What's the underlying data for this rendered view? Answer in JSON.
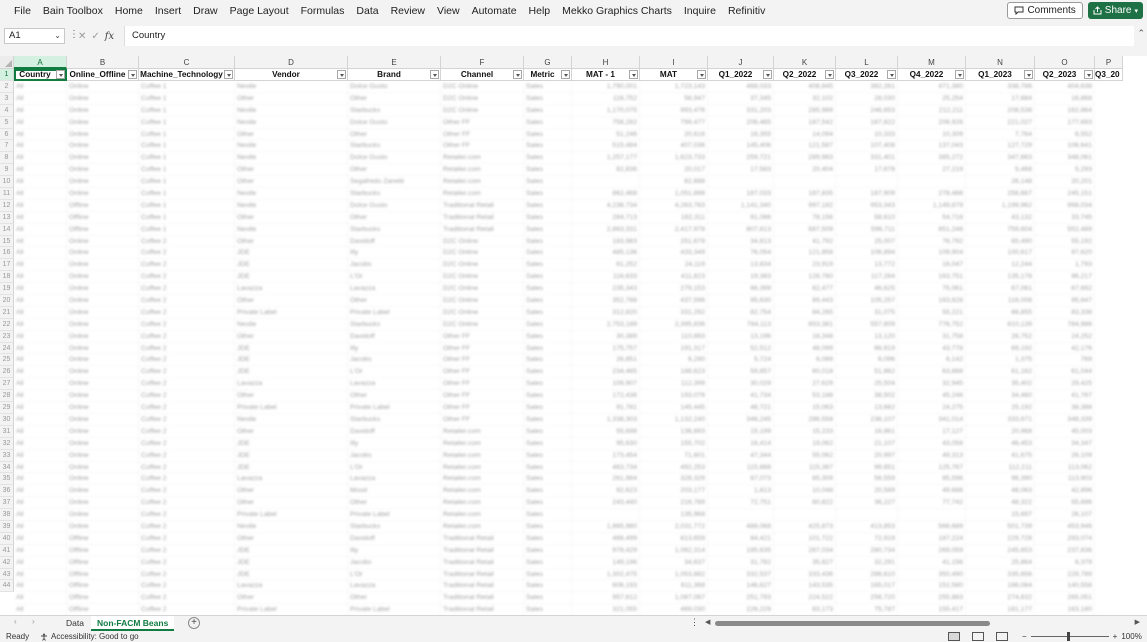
{
  "menu": {
    "items": [
      "File",
      "Bain Toolbox",
      "Home",
      "Insert",
      "Draw",
      "Page Layout",
      "Formulas",
      "Data",
      "Review",
      "View",
      "Automate",
      "Help",
      "Mekko Graphics Charts",
      "Inquire",
      "Refinitiv"
    ],
    "comments_label": "Comments",
    "share_label": "Share"
  },
  "formula_bar": {
    "name_box": "A1",
    "fx_label": "fx",
    "content": "Country"
  },
  "columns": {
    "letters": [
      "A",
      "B",
      "C",
      "D",
      "E",
      "F",
      "G",
      "H",
      "I",
      "J",
      "K",
      "L",
      "M",
      "N",
      "O",
      "P"
    ],
    "headers": [
      "Country",
      "Online_Offline",
      "Machine_Technology",
      "Vendor",
      "Brand",
      "Channel",
      "Metric",
      "MAT - 1",
      "MAT",
      "Q1_2022",
      "Q2_2022",
      "Q3_2022",
      "Q4_2022",
      "Q1_2023",
      "Q2_2023",
      "Q3_20"
    ]
  },
  "row_numbers": [
    "1",
    "2",
    "3",
    "4",
    "5",
    "6",
    "7",
    "8",
    "9",
    "10",
    "11",
    "12",
    "13",
    "14",
    "15",
    "16",
    "17",
    "18",
    "19",
    "20",
    "21",
    "22",
    "23",
    "24",
    "25",
    "26",
    "27",
    "28",
    "29",
    "30",
    "31",
    "32",
    "33",
    "34",
    "35",
    "36",
    "37",
    "38",
    "39",
    "40",
    "41",
    "42",
    "43",
    "44"
  ],
  "rows": [
    [
      "All",
      "Online",
      "Coffee 1",
      "Nestle",
      "Dolce Gusto",
      "D2C Online",
      "Sales",
      "1,790,001",
      "1,723,143",
      "468,033",
      "408,845",
      "382,261",
      "471,380",
      "338,786",
      "404,638"
    ],
    [
      "All",
      "Online",
      "Coffee 1",
      "Other",
      "Other",
      "D2C Online",
      "Sales",
      "116,752",
      "56,947",
      "37,345",
      "32,102",
      "28,030",
      "25,254",
      "17,684",
      "16,868"
    ],
    [
      "All",
      "Online",
      "Coffee 1",
      "Nestle",
      "Starbucks",
      "D2C Online",
      "Sales",
      "1,170,075",
      "993,476",
      "331,203",
      "285,989",
      "246,653",
      "212,211",
      "208,538",
      "162,864"
    ],
    [
      "All",
      "Online",
      "Coffee 1",
      "Nestle",
      "Dolce Gusto",
      "Other FF",
      "Sales",
      "758,282",
      "799,477",
      "206,465",
      "187,542",
      "167,822",
      "206,926",
      "221,027",
      "177,693"
    ],
    [
      "All",
      "Online",
      "Coffee 1",
      "Other",
      "Other",
      "Other FF",
      "Sales",
      "51,246",
      "20,616",
      "16,355",
      "14,094",
      "10,333",
      "10,309",
      "7,764",
      "6,552"
    ],
    [
      "All",
      "Online",
      "Coffee 1",
      "Nestle",
      "Starbucks",
      "Other FF",
      "Sales",
      "515,484",
      "407,036",
      "145,406",
      "121,587",
      "107,408",
      "137,043",
      "127,729",
      "106,641"
    ],
    [
      "All",
      "Online",
      "Coffee 1",
      "Nestle",
      "Dolce Gusto",
      "Retailer.com",
      "Sales",
      "1,257,177",
      "1,623,733",
      "259,721",
      "289,983",
      "331,401",
      "385,272",
      "347,663",
      "348,061"
    ],
    [
      "All",
      "Online",
      "Coffee 1",
      "Other",
      "Other",
      "Retailer.com",
      "Sales",
      "82,836",
      "20,017",
      "17,583",
      "20,404",
      "17,678",
      "27,219",
      "5,468",
      "5,293"
    ],
    [
      "All",
      "Online",
      "Coffee 1",
      "Other",
      "Segafredo Zanetti",
      "Retailer.com",
      "Sales",
      "",
      "82,688",
      "",
      "",
      "",
      "",
      "26,148",
      "20,201"
    ],
    [
      "All",
      "Online",
      "Coffee 1",
      "Nestle",
      "Starbucks",
      "Retailer.com",
      "Sales",
      "862,468",
      "1,051,898",
      "187,033",
      "187,835",
      "187,909",
      "278,488",
      "256,667",
      "245,151"
    ],
    [
      "All",
      "Offline",
      "Coffee 1",
      "Nestle",
      "Dolce Gusto",
      "Traditional Retail",
      "Sales",
      "4,238,734",
      "4,263,783",
      "1,141,340",
      "997,182",
      "953,343",
      "1,149,879",
      "1,199,962",
      "998,034"
    ],
    [
      "All",
      "Offline",
      "Coffee 1",
      "Other",
      "Other",
      "Traditional Retail",
      "Sales",
      "284,713",
      "182,311",
      "91,086",
      "78,156",
      "58,610",
      "54,718",
      "43,132",
      "33,745"
    ],
    [
      "All",
      "Offline",
      "Coffee 1",
      "Nestle",
      "Starbucks",
      "Traditional Retail",
      "Sales",
      "2,863,331",
      "2,417,978",
      "807,813",
      "687,509",
      "596,711",
      "851,248",
      "759,604",
      "552,489"
    ],
    [
      "All",
      "Online",
      "Coffee 2",
      "Other",
      "Davidoff",
      "D2C Online",
      "Sales",
      "183,983",
      "251,679",
      "34,813",
      "41,792",
      "25,007",
      "76,792",
      "65,490",
      "55,192"
    ],
    [
      "All",
      "Online",
      "Coffee 2",
      "JDE",
      "Illy",
      "D2C Online",
      "Sales",
      "485,136",
      "433,349",
      "76,054",
      "121,858",
      "106,894",
      "109,904",
      "100,617",
      "97,620"
    ],
    [
      "All",
      "Online",
      "Coffee 2",
      "JDE",
      "Jacobs",
      "D2C Online",
      "Sales",
      "61,252",
      "24,119",
      "13,834",
      "23,919",
      "13,772",
      "16,047",
      "12,244",
      "1,793"
    ],
    [
      "All",
      "Online",
      "Coffee 2",
      "JDE",
      "L'Or",
      "D2C Online",
      "Sales",
      "116,633",
      "411,823",
      "19,383",
      "128,780",
      "117,264",
      "163,751",
      "135,178",
      "96,217"
    ],
    [
      "All",
      "Online",
      "Coffee 2",
      "Lavazza",
      "Lavazza",
      "D2C Online",
      "Sales",
      "235,343",
      "279,153",
      "66,399",
      "62,477",
      "46,625",
      "75,061",
      "67,061",
      "67,692"
    ],
    [
      "All",
      "Online",
      "Coffee 2",
      "Other",
      "Other",
      "D2C Online",
      "Sales",
      "352,788",
      "437,596",
      "95,630",
      "89,443",
      "105,257",
      "163,828",
      "116,008",
      "95,647"
    ],
    [
      "All",
      "Online",
      "Coffee 2",
      "Private Label",
      "Private Label",
      "D2C Online",
      "Sales",
      "312,820",
      "331,292",
      "82,754",
      "84,265",
      "31,075",
      "55,221",
      "66,855",
      "83,338"
    ],
    [
      "All",
      "Online",
      "Coffee 2",
      "Nestle",
      "Starbucks",
      "D2C Online",
      "Sales",
      "2,753,189",
      "2,395,836",
      "784,113",
      "653,381",
      "557,809",
      "776,752",
      "810,139",
      "784,986"
    ],
    [
      "All",
      "Online",
      "Coffee 2",
      "Other",
      "Davidoff",
      "Other FF",
      "Sales",
      "30,389",
      "110,893",
      "13,196",
      "18,348",
      "13,120",
      "31,758",
      "26,752",
      "24,252"
    ],
    [
      "All",
      "Online",
      "Coffee 2",
      "JDE",
      "Illy",
      "Other FF",
      "Sales",
      "175,757",
      "191,317",
      "52,512",
      "48,099",
      "66,919",
      "43,778",
      "69,192",
      "42,176"
    ],
    [
      "All",
      "Online",
      "Coffee 2",
      "JDE",
      "Jacobs",
      "Other FF",
      "Sales",
      "26,851",
      "6,290",
      "5,724",
      "6,089",
      "6,096",
      "6,142",
      "1,375",
      "769"
    ],
    [
      "All",
      "Online",
      "Coffee 2",
      "JDE",
      "L'Or",
      "Other FF",
      "Sales",
      "234,465",
      "188,623",
      "59,857",
      "60,018",
      "51,862",
      "63,888",
      "61,162",
      "61,044"
    ],
    [
      "All",
      "Online",
      "Coffee 2",
      "Lavazza",
      "Lavazza",
      "Other FF",
      "Sales",
      "109,907",
      "112,399",
      "30,029",
      "27,629",
      "25,504",
      "32,945",
      "35,402",
      "29,425"
    ],
    [
      "All",
      "Online",
      "Coffee 2",
      "Other",
      "Other",
      "Other FF",
      "Sales",
      "172,436",
      "193,076",
      "41,734",
      "53,188",
      "38,502",
      "45,246",
      "34,460",
      "41,767"
    ],
    [
      "All",
      "Online",
      "Coffee 2",
      "Private Label",
      "Private Label",
      "Other FF",
      "Sales",
      "91,781",
      "145,445",
      "48,721",
      "15,063",
      "13,662",
      "24,275",
      "25,192",
      "38,388"
    ],
    [
      "All",
      "Online",
      "Coffee 2",
      "Nestle",
      "Starbucks",
      "Other FF",
      "Sales",
      "1,338,303",
      "1,132,240",
      "346,245",
      "286,558",
      "236,107",
      "341,014",
      "333,671",
      "348,339"
    ],
    [
      "All",
      "Online",
      "Coffee 2",
      "Other",
      "Davidoff",
      "Retailer.com",
      "Sales",
      "55,698",
      "136,893",
      "15,199",
      "15,233",
      "16,861",
      "17,127",
      "20,968",
      "45,003"
    ],
    [
      "All",
      "Online",
      "Coffee 2",
      "JDE",
      "Illy",
      "Retailer.com",
      "Sales",
      "95,630",
      "155,702",
      "16,414",
      "19,062",
      "21,107",
      "43,058",
      "46,453",
      "34,347"
    ],
    [
      "All",
      "Online",
      "Coffee 2",
      "JDE",
      "Jacobs",
      "Retailer.com",
      "Sales",
      "173,454",
      "71,801",
      "47,344",
      "55,062",
      "20,997",
      "49,313",
      "41,675",
      "26,109"
    ],
    [
      "All",
      "Online",
      "Coffee 2",
      "JDE",
      "L'Or",
      "Retailer.com",
      "Sales",
      "463,734",
      "492,253",
      "115,888",
      "115,387",
      "99,651",
      "125,767",
      "112,211",
      "113,062"
    ],
    [
      "All",
      "Online",
      "Coffee 2",
      "Lavazza",
      "Lavazza",
      "Retailer.com",
      "Sales",
      "261,984",
      "328,329",
      "67,073",
      "65,309",
      "56,559",
      "85,596",
      "96,390",
      "113,903"
    ],
    [
      "All",
      "Online",
      "Coffee 2",
      "Other",
      "Mood",
      "Retailer.com",
      "Sales",
      "92,623",
      "203,177",
      "1,813",
      "10,048",
      "20,589",
      "49,688",
      "48,063",
      "42,896"
    ],
    [
      "All",
      "Online",
      "Coffee 2",
      "Other",
      "Other",
      "Retailer.com",
      "Sales",
      "243,440",
      "216,789",
      "72,751",
      "60,822",
      "36,227",
      "77,742",
      "48,322",
      "55,696"
    ],
    [
      "All",
      "Online",
      "Coffee 2",
      "Private Label",
      "Private Label",
      "Retailer.com",
      "Sales",
      "",
      "135,968",
      "",
      "",
      "",
      "",
      "15,697",
      "26,107"
    ],
    [
      "All",
      "Online",
      "Coffee 2",
      "Nestle",
      "Starbucks",
      "Retailer.com",
      "Sales",
      "1,865,980",
      "2,031,772",
      "488,068",
      "425,873",
      "413,853",
      "566,689",
      "501,739",
      "453,946"
    ],
    [
      "All",
      "Offline",
      "Coffee 2",
      "Other",
      "Davidoff",
      "Traditional Retail",
      "Sales",
      "466,499",
      "813,659",
      "84,421",
      "101,722",
      "72,919",
      "187,224",
      "229,728",
      "293,074"
    ],
    [
      "All",
      "Offline",
      "Coffee 2",
      "JDE",
      "Illy",
      "Traditional Retail",
      "Sales",
      "978,429",
      "1,062,314",
      "185,635",
      "267,034",
      "280,734",
      "269,059",
      "245,653",
      "237,836"
    ],
    [
      "All",
      "Offline",
      "Coffee 2",
      "JDE",
      "Jacobs",
      "Traditional Retail",
      "Sales",
      "149,196",
      "34,637",
      "31,782",
      "35,827",
      "32,291",
      "41,156",
      "25,864",
      "6,379"
    ],
    [
      "All",
      "Offline",
      "Coffee 2",
      "JDE",
      "L'Or",
      "Traditional Retail",
      "Sales",
      "1,302,475",
      "1,053,882",
      "332,537",
      "333,436",
      "286,610",
      "350,490",
      "335,656",
      "229,789"
    ],
    [
      "All",
      "Offline",
      "Coffee 2",
      "Lavazza",
      "Lavazza",
      "Traditional Retail",
      "Sales",
      "606,193",
      "611,368",
      "146,627",
      "143,535",
      "165,017",
      "152,580",
      "166,084",
      "140,558"
    ],
    [
      "All",
      "Offline",
      "Coffee 2",
      "Other",
      "Other",
      "Traditional Retail",
      "Sales",
      "957,612",
      "1,087,067",
      "251,793",
      "224,522",
      "256,720",
      "255,883",
      "274,832",
      "265,051"
    ],
    [
      "All",
      "Offline",
      "Coffee 2",
      "Private Label",
      "Private Label",
      "Traditional Retail",
      "Sales",
      "321,055",
      "469,030",
      "226,229",
      "63,173",
      "75,787",
      "155,417",
      "181,177",
      "163,180"
    ]
  ],
  "sheets": {
    "tabs": [
      "Data",
      "Non-FACM Beans"
    ],
    "active": "Non-FACM Beans"
  },
  "status": {
    "ready": "Ready",
    "accessibility": "Accessibility: Good to go",
    "zoom": "100%"
  },
  "colors": {
    "accent": "#107c41",
    "share_button": "#1e7145"
  }
}
